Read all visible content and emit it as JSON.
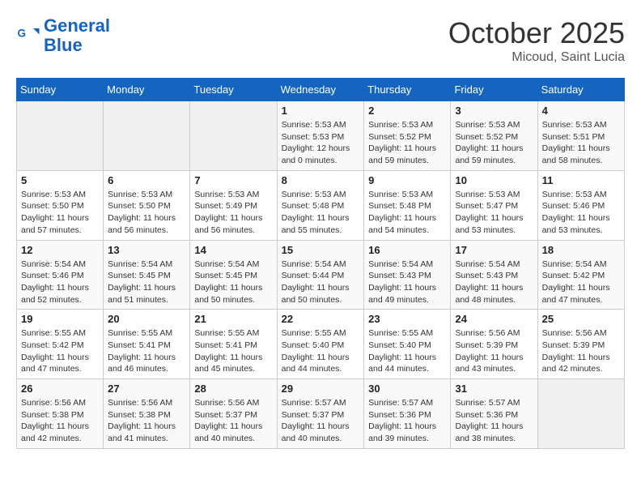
{
  "header": {
    "logo_line1": "General",
    "logo_line2": "Blue",
    "month": "October 2025",
    "location": "Micoud, Saint Lucia"
  },
  "days_of_week": [
    "Sunday",
    "Monday",
    "Tuesday",
    "Wednesday",
    "Thursday",
    "Friday",
    "Saturday"
  ],
  "weeks": [
    [
      {
        "day": "",
        "detail": ""
      },
      {
        "day": "",
        "detail": ""
      },
      {
        "day": "",
        "detail": ""
      },
      {
        "day": "1",
        "detail": "Sunrise: 5:53 AM\nSunset: 5:53 PM\nDaylight: 12 hours\nand 0 minutes."
      },
      {
        "day": "2",
        "detail": "Sunrise: 5:53 AM\nSunset: 5:52 PM\nDaylight: 11 hours\nand 59 minutes."
      },
      {
        "day": "3",
        "detail": "Sunrise: 5:53 AM\nSunset: 5:52 PM\nDaylight: 11 hours\nand 59 minutes."
      },
      {
        "day": "4",
        "detail": "Sunrise: 5:53 AM\nSunset: 5:51 PM\nDaylight: 11 hours\nand 58 minutes."
      }
    ],
    [
      {
        "day": "5",
        "detail": "Sunrise: 5:53 AM\nSunset: 5:50 PM\nDaylight: 11 hours\nand 57 minutes."
      },
      {
        "day": "6",
        "detail": "Sunrise: 5:53 AM\nSunset: 5:50 PM\nDaylight: 11 hours\nand 56 minutes."
      },
      {
        "day": "7",
        "detail": "Sunrise: 5:53 AM\nSunset: 5:49 PM\nDaylight: 11 hours\nand 56 minutes."
      },
      {
        "day": "8",
        "detail": "Sunrise: 5:53 AM\nSunset: 5:48 PM\nDaylight: 11 hours\nand 55 minutes."
      },
      {
        "day": "9",
        "detail": "Sunrise: 5:53 AM\nSunset: 5:48 PM\nDaylight: 11 hours\nand 54 minutes."
      },
      {
        "day": "10",
        "detail": "Sunrise: 5:53 AM\nSunset: 5:47 PM\nDaylight: 11 hours\nand 53 minutes."
      },
      {
        "day": "11",
        "detail": "Sunrise: 5:53 AM\nSunset: 5:46 PM\nDaylight: 11 hours\nand 53 minutes."
      }
    ],
    [
      {
        "day": "12",
        "detail": "Sunrise: 5:54 AM\nSunset: 5:46 PM\nDaylight: 11 hours\nand 52 minutes."
      },
      {
        "day": "13",
        "detail": "Sunrise: 5:54 AM\nSunset: 5:45 PM\nDaylight: 11 hours\nand 51 minutes."
      },
      {
        "day": "14",
        "detail": "Sunrise: 5:54 AM\nSunset: 5:45 PM\nDaylight: 11 hours\nand 50 minutes."
      },
      {
        "day": "15",
        "detail": "Sunrise: 5:54 AM\nSunset: 5:44 PM\nDaylight: 11 hours\nand 50 minutes."
      },
      {
        "day": "16",
        "detail": "Sunrise: 5:54 AM\nSunset: 5:43 PM\nDaylight: 11 hours\nand 49 minutes."
      },
      {
        "day": "17",
        "detail": "Sunrise: 5:54 AM\nSunset: 5:43 PM\nDaylight: 11 hours\nand 48 minutes."
      },
      {
        "day": "18",
        "detail": "Sunrise: 5:54 AM\nSunset: 5:42 PM\nDaylight: 11 hours\nand 47 minutes."
      }
    ],
    [
      {
        "day": "19",
        "detail": "Sunrise: 5:55 AM\nSunset: 5:42 PM\nDaylight: 11 hours\nand 47 minutes."
      },
      {
        "day": "20",
        "detail": "Sunrise: 5:55 AM\nSunset: 5:41 PM\nDaylight: 11 hours\nand 46 minutes."
      },
      {
        "day": "21",
        "detail": "Sunrise: 5:55 AM\nSunset: 5:41 PM\nDaylight: 11 hours\nand 45 minutes."
      },
      {
        "day": "22",
        "detail": "Sunrise: 5:55 AM\nSunset: 5:40 PM\nDaylight: 11 hours\nand 44 minutes."
      },
      {
        "day": "23",
        "detail": "Sunrise: 5:55 AM\nSunset: 5:40 PM\nDaylight: 11 hours\nand 44 minutes."
      },
      {
        "day": "24",
        "detail": "Sunrise: 5:56 AM\nSunset: 5:39 PM\nDaylight: 11 hours\nand 43 minutes."
      },
      {
        "day": "25",
        "detail": "Sunrise: 5:56 AM\nSunset: 5:39 PM\nDaylight: 11 hours\nand 42 minutes."
      }
    ],
    [
      {
        "day": "26",
        "detail": "Sunrise: 5:56 AM\nSunset: 5:38 PM\nDaylight: 11 hours\nand 42 minutes."
      },
      {
        "day": "27",
        "detail": "Sunrise: 5:56 AM\nSunset: 5:38 PM\nDaylight: 11 hours\nand 41 minutes."
      },
      {
        "day": "28",
        "detail": "Sunrise: 5:56 AM\nSunset: 5:37 PM\nDaylight: 11 hours\nand 40 minutes."
      },
      {
        "day": "29",
        "detail": "Sunrise: 5:57 AM\nSunset: 5:37 PM\nDaylight: 11 hours\nand 40 minutes."
      },
      {
        "day": "30",
        "detail": "Sunrise: 5:57 AM\nSunset: 5:36 PM\nDaylight: 11 hours\nand 39 minutes."
      },
      {
        "day": "31",
        "detail": "Sunrise: 5:57 AM\nSunset: 5:36 PM\nDaylight: 11 hours\nand 38 minutes."
      },
      {
        "day": "",
        "detail": ""
      }
    ]
  ]
}
